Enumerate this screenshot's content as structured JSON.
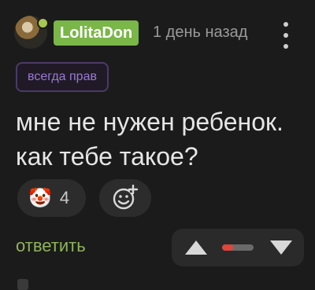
{
  "comment": {
    "author": "LolitaDon",
    "time": "1 день назад",
    "tag": "всегда прав",
    "text_lines": [
      "мне не нужен ребенок.",
      "как тебе такое?"
    ]
  },
  "reactions": {
    "emoji": "🤡",
    "count": "4"
  },
  "actions": {
    "reply_label": "ответить"
  },
  "rating": {
    "negative_fraction": 0.35
  },
  "icons": {
    "more": "more-vertical-icon",
    "add_reaction": "add-reaction-icon",
    "vote_up": "triangle-up-icon",
    "vote_down": "triangle-down-icon"
  },
  "colors": {
    "background": "#1b1b1b",
    "user_badge": "#7ab648",
    "tag_text": "#9a7ad0",
    "reply": "#8fb35a",
    "rating_negative": "#e0453a"
  }
}
